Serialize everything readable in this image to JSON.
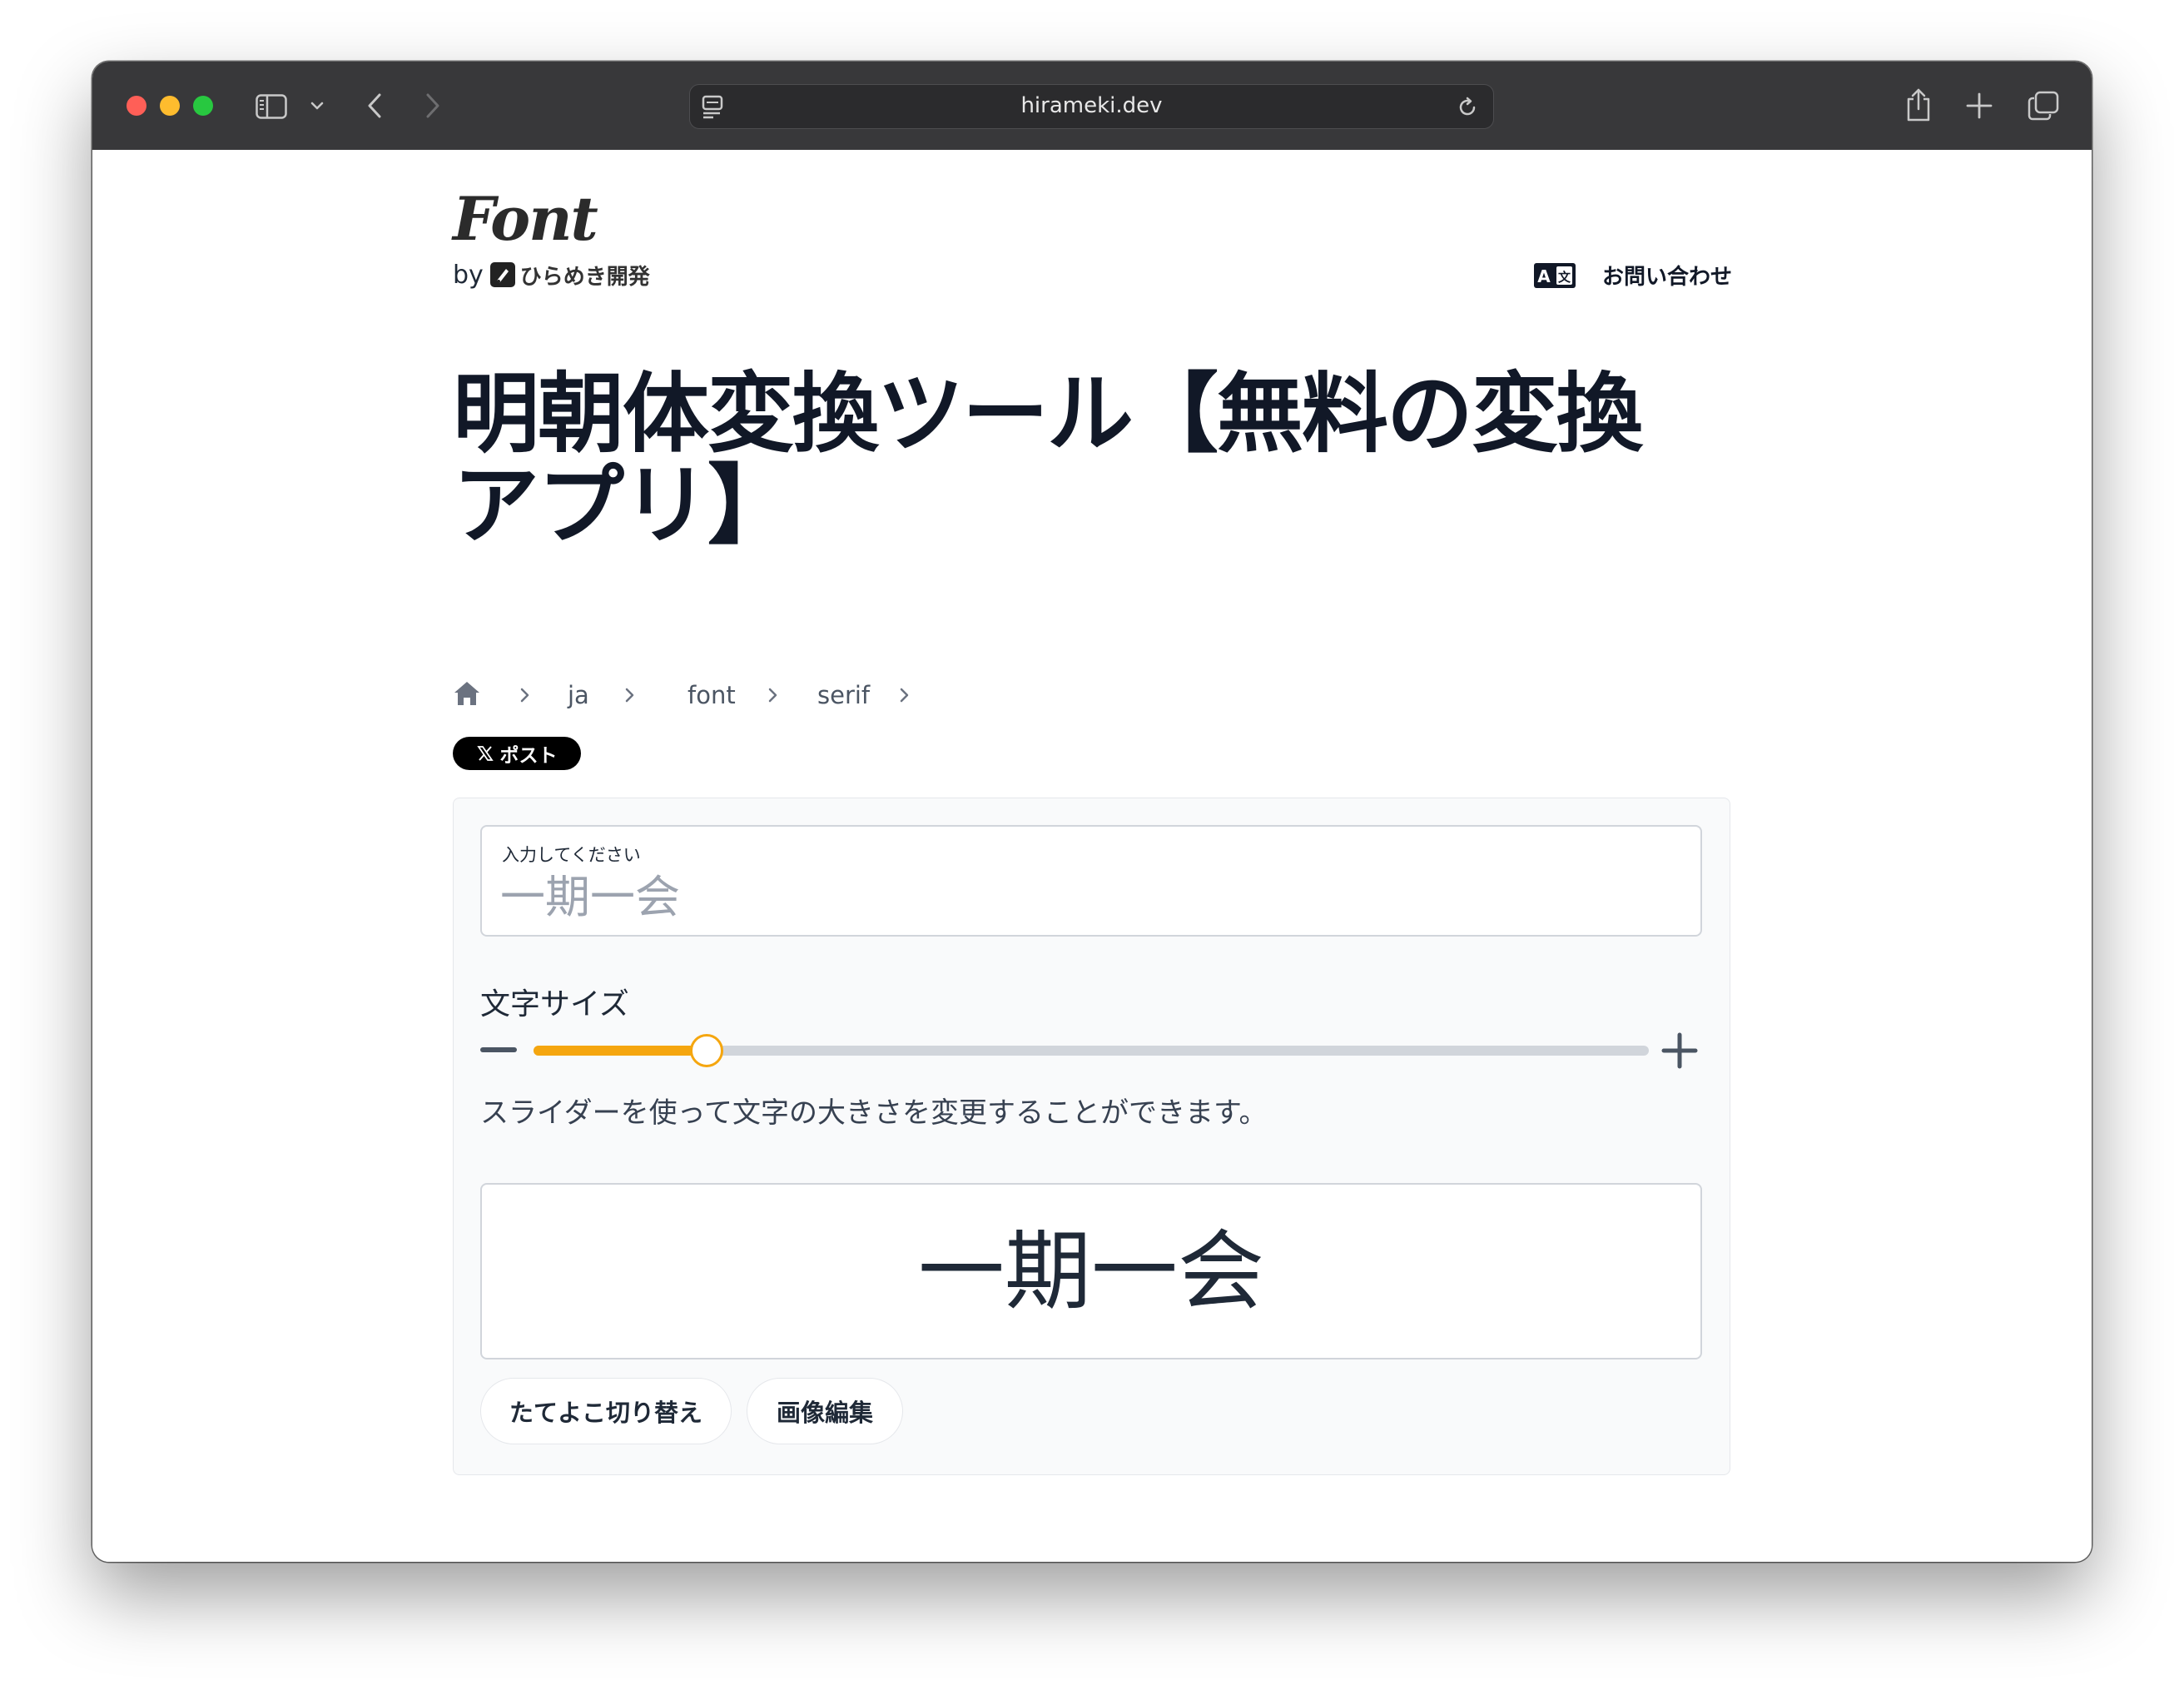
{
  "browser": {
    "url": "hirameki.dev"
  },
  "header": {
    "logo": "Font",
    "by": "by",
    "brand": "ひらめき開発",
    "contact": "お問い合わせ"
  },
  "page": {
    "title_line1": "明朝体変換ツール【無料の変換",
    "title_line2": "アプリ】"
  },
  "breadcrumb": {
    "items": [
      "ja",
      "font",
      "serif"
    ]
  },
  "share": {
    "post_label": "ポスト"
  },
  "converter": {
    "input_label": "入力してください",
    "input_placeholder": "一期一会",
    "size_label": "文字サイズ",
    "size_fraction": 0.155,
    "slider_help": "スライダーを使って文字の大きさを変更することができます。",
    "preview_text": "一期一会",
    "toggle_direction_label": "たてよこ切り替え",
    "image_edit_label": "画像編集"
  },
  "colors": {
    "accent": "#f5a60f",
    "titlebar": "#38383a",
    "text_dark": "#111827"
  }
}
